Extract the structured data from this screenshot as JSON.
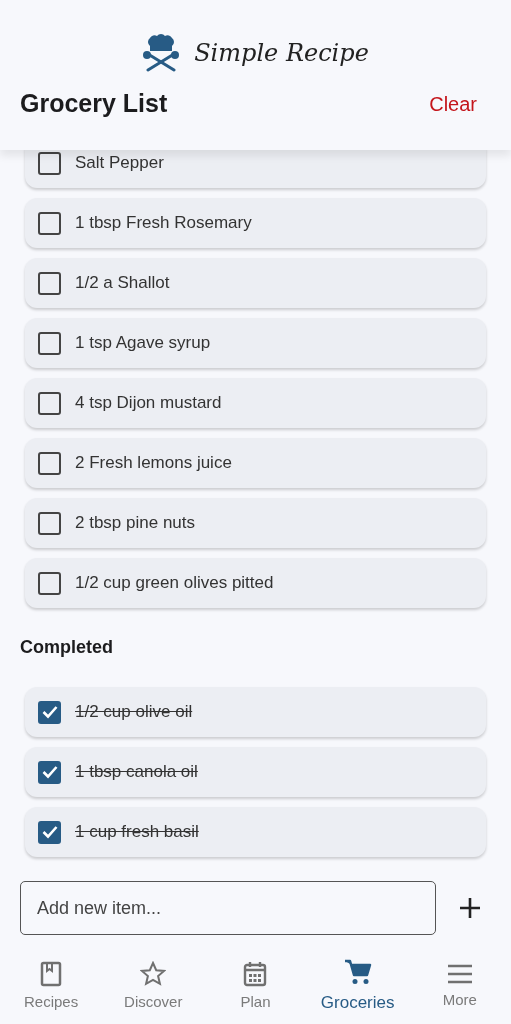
{
  "app": {
    "logo_text": "Simple Recipe"
  },
  "header": {
    "title": "Grocery List",
    "action": "Clear"
  },
  "items": [
    {
      "label": "Salt Pepper",
      "checked": false
    },
    {
      "label": "1 tbsp Fresh Rosemary",
      "checked": false
    },
    {
      "label": "1/2 a Shallot",
      "checked": false
    },
    {
      "label": "1 tsp Agave syrup",
      "checked": false
    },
    {
      "label": "4 tsp Dijon mustard",
      "checked": false
    },
    {
      "label": "2 Fresh lemons juice",
      "checked": false
    },
    {
      "label": "2 tbsp pine nuts",
      "checked": false
    },
    {
      "label": "1/2 cup green olives pitted",
      "checked": false
    }
  ],
  "completed_heading": "Completed",
  "completed": [
    {
      "label": "1/2 cup olive oil",
      "checked": true
    },
    {
      "label": "1 tbsp canola oil",
      "checked": true
    },
    {
      "label": "1 cup fresh basil",
      "checked": true
    }
  ],
  "new_item": {
    "placeholder": "Add new item..."
  },
  "nav": [
    {
      "label": "Recipes",
      "selected": false
    },
    {
      "label": "Discover",
      "selected": false
    },
    {
      "label": "Plan",
      "selected": false
    },
    {
      "label": "Groceries",
      "selected": true
    },
    {
      "label": "More",
      "selected": false
    }
  ]
}
